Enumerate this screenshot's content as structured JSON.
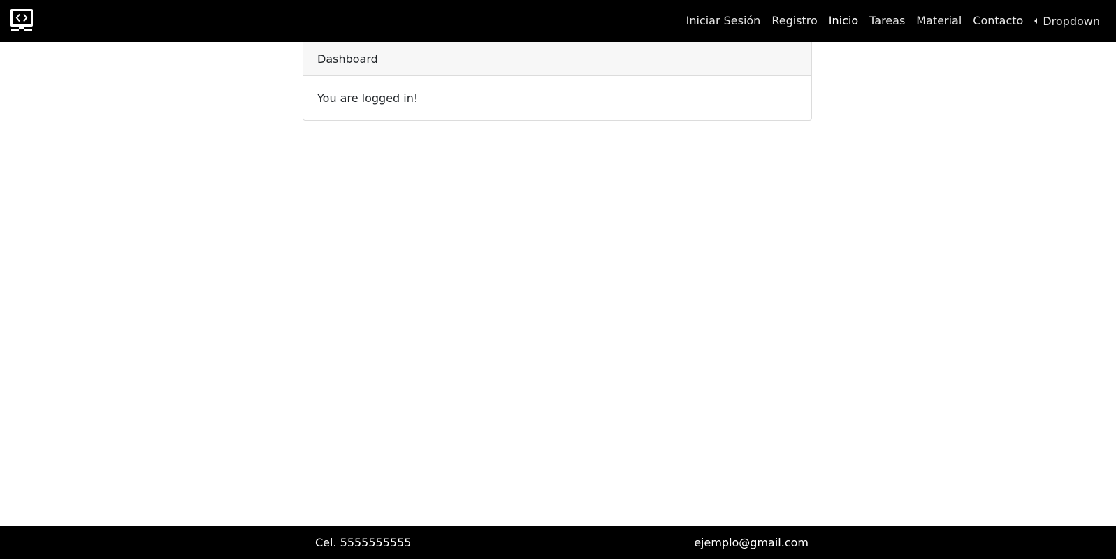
{
  "navbar": {
    "logo_icon": "computer-code-icon",
    "links": [
      {
        "label": "Iniciar Sesión"
      },
      {
        "label": "Registro"
      },
      {
        "label": "Inicio",
        "active": true
      },
      {
        "label": "Tareas"
      },
      {
        "label": "Material"
      },
      {
        "label": "Contacto"
      }
    ],
    "dropdown": {
      "label": "Dropdown",
      "icon": "caret-left-icon"
    }
  },
  "card": {
    "header": "Dashboard",
    "body": "You are logged in!"
  },
  "footer": {
    "phone": "Cel. 5555555555",
    "email": "ejemplo@gmail.com"
  },
  "colors": {
    "navbar_bg": "#000000",
    "footer_bg": "#000000",
    "card_header_bg": "#f7f7f7"
  }
}
